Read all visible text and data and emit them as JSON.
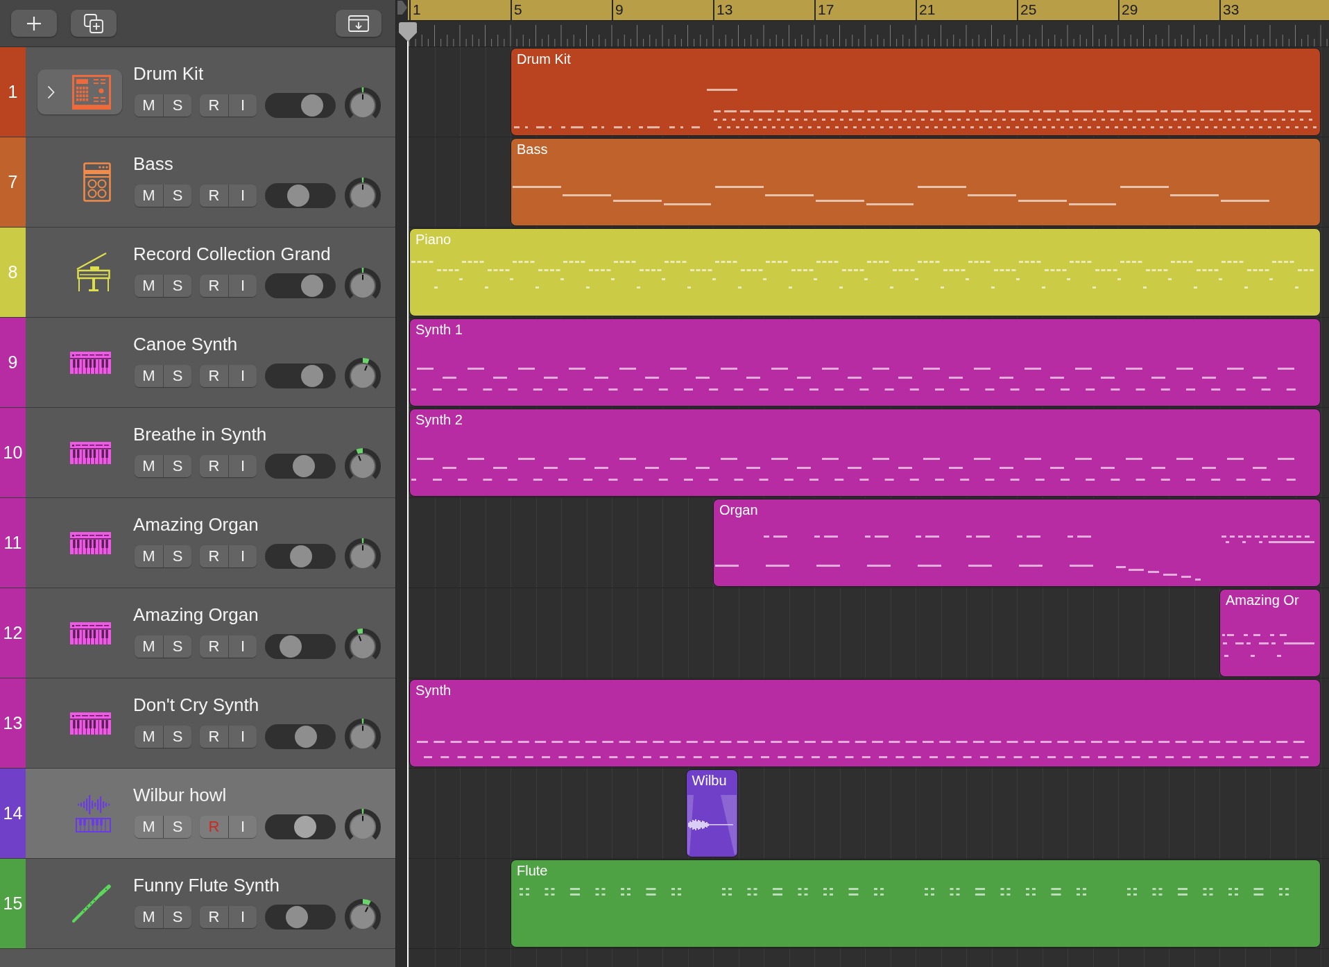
{
  "ruler": {
    "bars": [
      "1",
      "5",
      "9",
      "13",
      "17",
      "21",
      "25",
      "29",
      "33"
    ]
  },
  "tracks": [
    {
      "number": "1",
      "name": "Drum Kit",
      "kind": "drums",
      "color": "#b9441f",
      "selected": false,
      "stack": {
        "expanded": false
      },
      "buttons": [
        {
          "kind": "mute",
          "label": "M",
          "on": false
        },
        {
          "kind": "solo",
          "label": "S",
          "on": false
        },
        {
          "kind": "record",
          "label": "R",
          "on": false
        },
        {
          "kind": "input",
          "label": "I",
          "on": false
        }
      ],
      "volume": {
        "level": 0.75
      },
      "pan": {
        "level": 0.5
      },
      "region": {
        "kind": "midi",
        "name": "Drum Kit"
      }
    },
    {
      "number": "7",
      "name": "Bass",
      "kind": "bass",
      "color": "#c0622b",
      "selected": false,
      "buttons": [
        {
          "kind": "mute",
          "label": "M",
          "on": false
        },
        {
          "kind": "solo",
          "label": "S",
          "on": false
        },
        {
          "kind": "record",
          "label": "R",
          "on": false
        },
        {
          "kind": "input",
          "label": "I",
          "on": false
        }
      ],
      "volume": {
        "level": 0.45
      },
      "pan": {
        "level": 0.5
      },
      "region": {
        "kind": "midi",
        "name": "Bass"
      }
    },
    {
      "number": "8",
      "name": "Record Collection Grand",
      "kind": "piano",
      "color": "#cbcb45",
      "selected": false,
      "buttons": [
        {
          "kind": "mute",
          "label": "M",
          "on": false
        },
        {
          "kind": "solo",
          "label": "S",
          "on": false
        },
        {
          "kind": "record",
          "label": "R",
          "on": false
        },
        {
          "kind": "input",
          "label": "I",
          "on": false
        }
      ],
      "volume": {
        "level": 0.75
      },
      "pan": {
        "level": 0.5
      },
      "region": {
        "kind": "midi",
        "name": "Piano"
      }
    },
    {
      "number": "9",
      "name": "Canoe Synth",
      "kind": "synth",
      "color": "#b82ca3",
      "selected": false,
      "buttons": [
        {
          "kind": "mute",
          "label": "M",
          "on": false
        },
        {
          "kind": "solo",
          "label": "S",
          "on": false
        },
        {
          "kind": "record",
          "label": "R",
          "on": false
        },
        {
          "kind": "input",
          "label": "I",
          "on": false
        }
      ],
      "volume": {
        "level": 0.75
      },
      "pan": {
        "level": 0.58
      },
      "region": {
        "kind": "midi",
        "name": "Synth 1"
      }
    },
    {
      "number": "10",
      "name": "Breathe in Synth",
      "kind": "synth",
      "color": "#b82ca3",
      "selected": false,
      "buttons": [
        {
          "kind": "mute",
          "label": "M",
          "on": false
        },
        {
          "kind": "solo",
          "label": "S",
          "on": false
        },
        {
          "kind": "record",
          "label": "R",
          "on": false
        },
        {
          "kind": "input",
          "label": "I",
          "on": false
        }
      ],
      "volume": {
        "level": 0.57
      },
      "pan": {
        "level": 0.42
      },
      "region": {
        "kind": "midi",
        "name": "Synth 2"
      }
    },
    {
      "number": "11",
      "name": "Amazing Organ",
      "kind": "synth",
      "color": "#b82ca3",
      "selected": false,
      "buttons": [
        {
          "kind": "mute",
          "label": "M",
          "on": false
        },
        {
          "kind": "solo",
          "label": "S",
          "on": false
        },
        {
          "kind": "record",
          "label": "R",
          "on": false
        },
        {
          "kind": "input",
          "label": "I",
          "on": false
        }
      ],
      "volume": {
        "level": 0.51
      },
      "pan": {
        "level": 0.5
      },
      "region": {
        "kind": "midi",
        "name": "Organ"
      }
    },
    {
      "number": "12",
      "name": "Amazing Organ",
      "kind": "synth",
      "color": "#b82ca3",
      "selected": false,
      "buttons": [
        {
          "kind": "mute",
          "label": "M",
          "on": false
        },
        {
          "kind": "solo",
          "label": "S",
          "on": false
        },
        {
          "kind": "record",
          "label": "R",
          "on": false
        },
        {
          "kind": "input",
          "label": "I",
          "on": false
        }
      ],
      "volume": {
        "level": 0.29
      },
      "pan": {
        "level": 0.43
      },
      "region": {
        "kind": "midi",
        "name": "Amazing Or"
      }
    },
    {
      "number": "13",
      "name": "Don't Cry Synth",
      "kind": "synth",
      "color": "#b82ca3",
      "selected": false,
      "buttons": [
        {
          "kind": "mute",
          "label": "M",
          "on": false
        },
        {
          "kind": "solo",
          "label": "S",
          "on": false
        },
        {
          "kind": "record",
          "label": "R",
          "on": false
        },
        {
          "kind": "input",
          "label": "I",
          "on": false
        }
      ],
      "volume": {
        "level": 0.62
      },
      "pan": {
        "level": 0.5
      },
      "region": {
        "kind": "midi",
        "name": "Synth"
      }
    },
    {
      "number": "14",
      "name": "Wilbur howl",
      "kind": "sampler",
      "color": "#7040c8",
      "selected": true,
      "buttons": [
        {
          "kind": "mute",
          "label": "M",
          "on": false
        },
        {
          "kind": "solo",
          "label": "S",
          "on": false
        },
        {
          "kind": "record",
          "label": "R",
          "on": true
        },
        {
          "kind": "input",
          "label": "I",
          "on": false
        }
      ],
      "volume": {
        "level": 0.61
      },
      "pan": {
        "level": 0.5
      },
      "region": {
        "kind": "audio",
        "name": "Wilbu"
      }
    },
    {
      "number": "15",
      "name": "Funny Flute Synth",
      "kind": "flute",
      "color": "#4ea244",
      "selected": false,
      "buttons": [
        {
          "kind": "mute",
          "label": "M",
          "on": false
        },
        {
          "kind": "solo",
          "label": "S",
          "on": false
        },
        {
          "kind": "record",
          "label": "R",
          "on": false
        },
        {
          "kind": "input",
          "label": "I",
          "on": false
        }
      ],
      "volume": {
        "level": 0.42
      },
      "pan": {
        "level": 0.6
      },
      "region": {
        "kind": "midi",
        "name": "Flute"
      }
    }
  ]
}
